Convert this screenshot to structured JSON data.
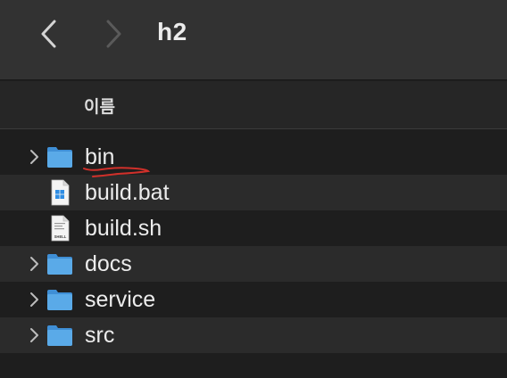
{
  "window": {
    "title": "h2",
    "back_icon": "chevron-left-icon",
    "forward_icon": "chevron-right-icon"
  },
  "header": {
    "name_column": "이름"
  },
  "files": [
    {
      "name": "bin",
      "kind": "folder",
      "expandable": true
    },
    {
      "name": "build.bat",
      "kind": "windows-batch-file",
      "expandable": false
    },
    {
      "name": "build.sh",
      "kind": "shell-script-file",
      "expandable": false,
      "icon_label": "SHELL"
    },
    {
      "name": "docs",
      "kind": "folder",
      "expandable": true
    },
    {
      "name": "service",
      "kind": "folder",
      "expandable": true
    },
    {
      "name": "src",
      "kind": "folder",
      "expandable": true
    }
  ],
  "colors": {
    "folder_blue": "#5aaae8",
    "annotation_red": "#d0302a"
  }
}
